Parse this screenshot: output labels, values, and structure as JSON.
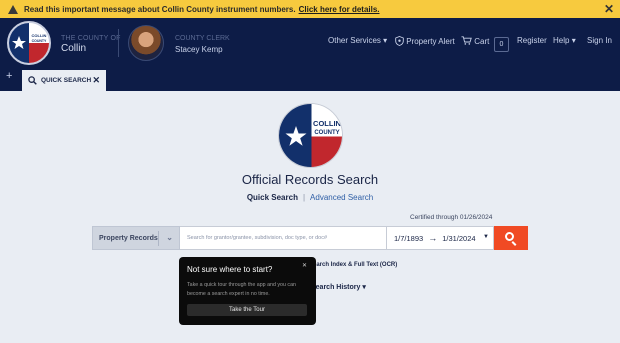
{
  "alert": {
    "message": "Read this important message about Collin County instrument numbers.",
    "link": "Click here for details."
  },
  "header": {
    "county_label": "THE COUNTY OF",
    "county_name": "Collin",
    "clerk_label": "COUNTY CLERK",
    "clerk_name": "Stacey Kemp",
    "nav": {
      "other_services": "Other Services",
      "property_alert": "Property Alert",
      "cart": "Cart",
      "cart_count": "0",
      "register": "Register",
      "help": "Help",
      "sign_in": "Sign In"
    }
  },
  "tabs": [
    {
      "label": "QUICK SEARCH"
    }
  ],
  "main": {
    "title": "Official Records Search",
    "quick_search": "Quick Search",
    "advanced_search": "Advanced Search",
    "certified": "Certified through 01/26/2024",
    "record_type": "Property Records",
    "search_placeholder": "Search for grantor/grantee, subdivision, doc type, or doc#",
    "date_from": "1/7/1893",
    "date_to": "1/31/2024",
    "option_ocr": "Search Index & Full Text (OCR)",
    "option_history": "Search History"
  },
  "tour": {
    "title": "Not sure where to start?",
    "body": "Take a quick tour through the app and you can become a search expert in no time.",
    "button": "Take the Tour"
  },
  "colors": {
    "alert_bg": "#f7ca3e",
    "header_bg": "#0d1c47",
    "search_button": "#f04a24",
    "page_bg": "#e9edf3"
  }
}
